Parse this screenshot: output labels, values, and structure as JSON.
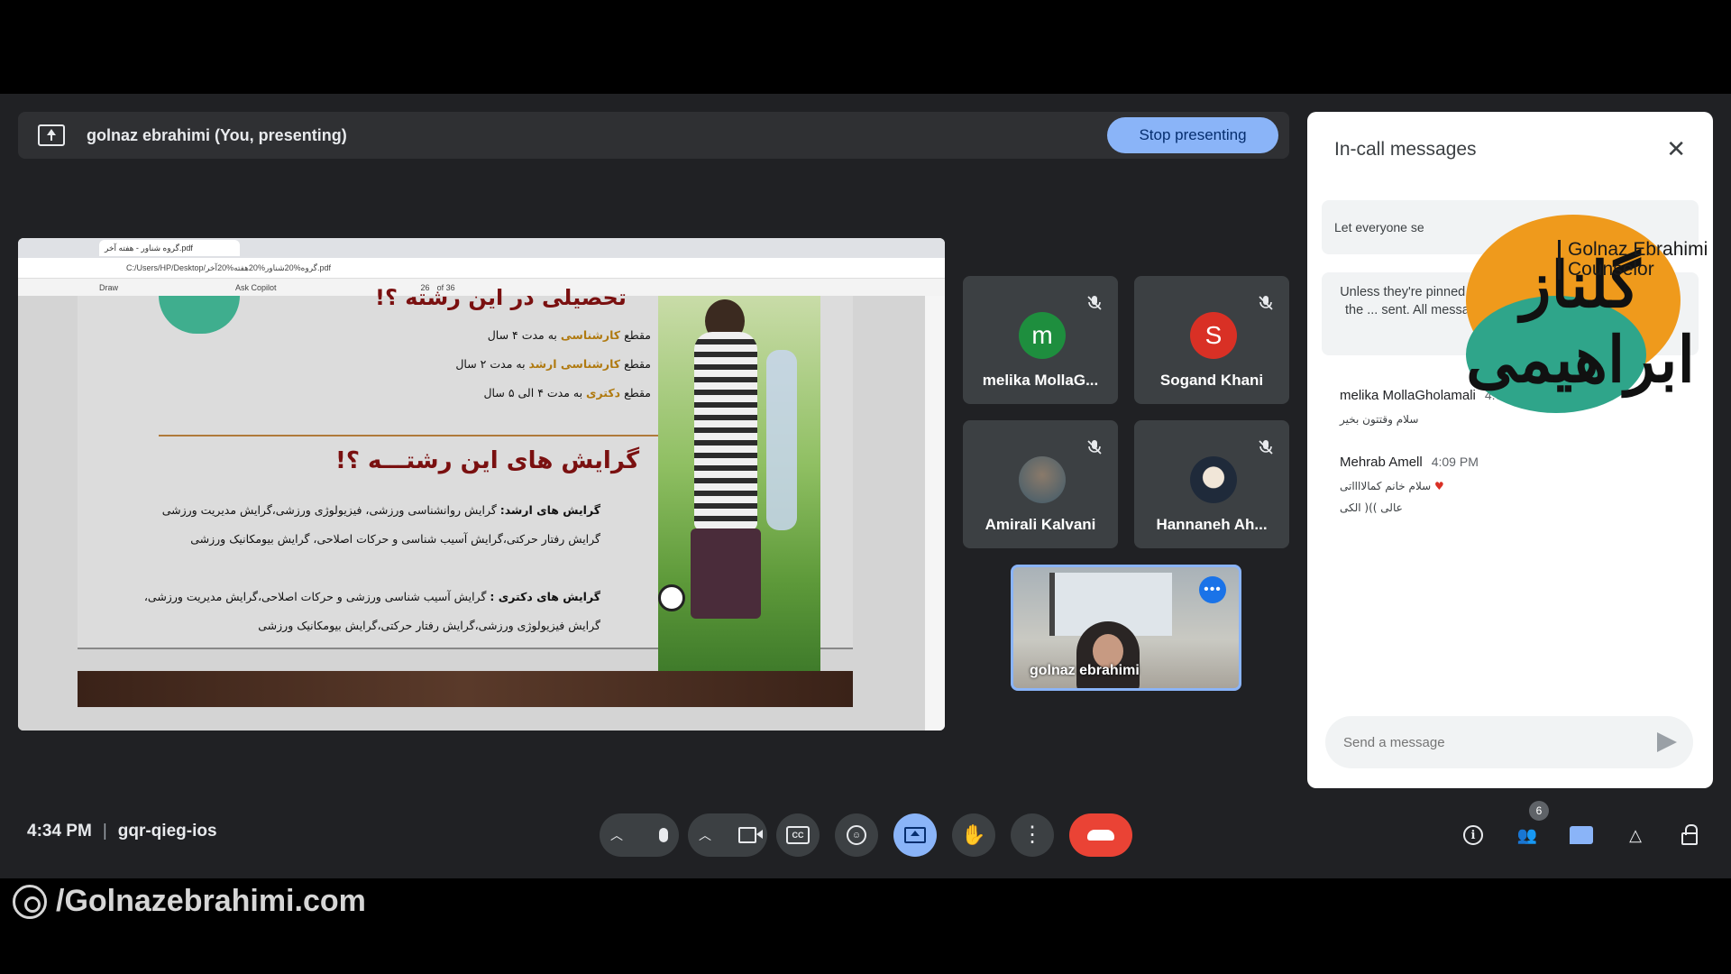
{
  "banner": {
    "text": "golnaz ebrahimi (You, presenting)",
    "stop_label": "Stop presenting"
  },
  "shared_screen": {
    "tab_title": "گروه شناور - هفته آخر.pdf",
    "address": "C:/Users/HP/Desktop/گروه%20شناور%20هفته%20آخر.pdf",
    "tools": [
      "Draw",
      "Ask Copilot"
    ],
    "page_num": "26",
    "page_total": "of 36",
    "pdf": {
      "heading_top": "تحصیلی در این رشته ؟!",
      "levels": [
        {
          "label": "کارشناسی",
          "prefix": "مقطع",
          "suffix": "به مدت ۴ سال"
        },
        {
          "label": "کارشناسی ارشد",
          "prefix": "مقطع",
          "suffix": "به مدت ۲ سال"
        },
        {
          "label": "دکتری",
          "prefix": "مقطع",
          "suffix": "به مدت ۴ الی ۵ سال"
        }
      ],
      "heading": "گرایش های این رشتـــه ؟!",
      "masters_label": "گرایش های ارشد:",
      "masters_line1": "گرایش روانشناسی ورزشی، فیزیولوژی ورزشی،گرایش مدیریت ورزشی",
      "masters_line2": "گرایش رفتار حرکتی،گرایش آسیب شناسی و حرکات اصلاحی، گرایش بیومکانیک ورزشی",
      "phd_label": "گرایش های دکتری :",
      "phd_line1": "گرایش آسیب شناسی ورزشی و حرکات اصلاحی،گرایش مدیریت ورزشی،",
      "phd_line2": "گرایش فیزیولوژی ورزشی،گرایش رفتار حرکتی،گرایش بیومکانیک ورزشی"
    }
  },
  "participants": [
    {
      "name": "melika MollaG...",
      "initial": "m",
      "color": "#1e8e3e"
    },
    {
      "name": "Sogand Khani",
      "initial": "S",
      "color": "#d93025"
    },
    {
      "name": "Amirali Kalvani",
      "initial": "",
      "color": "#6b8fa3"
    },
    {
      "name": "Hannaneh Ah...",
      "initial": "",
      "color": "#c9d6e3"
    }
  ],
  "self_tile": {
    "name": "golnaz ebrahimi"
  },
  "chat": {
    "title": "In-call messages",
    "toggle_label": "Let everyone se",
    "note": "Unless they're pinned, m... seen by people in the call when the ... sent. All messages are deleted when the call ends.",
    "messages": [
      {
        "sender": "melika MollaGholamali",
        "time": "4:04 PM",
        "lines": [
          "سلام وقتتون بخیر"
        ]
      },
      {
        "sender": "Mehrab Amell",
        "time": "4:09 PM",
        "lines": [
          "سلام خانم کمالااااتی",
          "عالی ))( الکی"
        ]
      }
    ],
    "input_placeholder": "Send a message"
  },
  "logo": {
    "name_line1": "Golnaz Ebrahimi",
    "name_line2": "Counselor",
    "script": "گلناز ابراهیمی"
  },
  "toolbar": {
    "time": "4:34 PM",
    "meeting_code": "gqr-qieg-ios",
    "people_count": "6"
  },
  "footer": {
    "text": "/Golnazebrahimi.com"
  },
  "colors": {
    "accent": "#8ab4f8",
    "end_call": "#ea4335",
    "surface": "#202124",
    "tile": "#3c4043"
  }
}
